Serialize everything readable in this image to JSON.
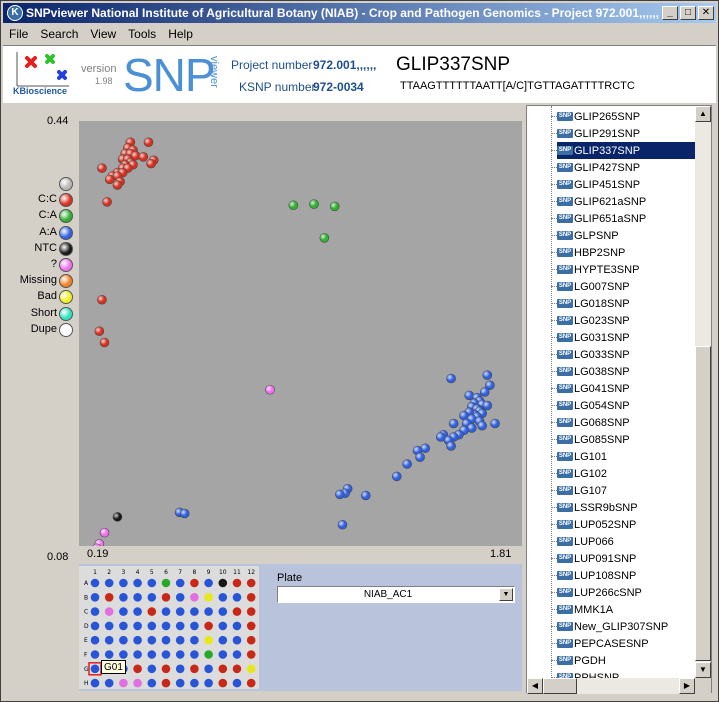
{
  "window": {
    "title": "SNPviewer   National Institute of Agricultural Botany (NIAB) - Crop and Pathogen Genomics - Project 972.001,,,,,,",
    "controls": [
      "_",
      "□",
      "✕"
    ]
  },
  "menu": [
    "File",
    "Search",
    "View",
    "Tools",
    "Help"
  ],
  "header": {
    "company": "KBioscience",
    "version_label": "version",
    "version": "1.98",
    "logo_text": "SNP",
    "logo_sub": "viewer",
    "project_label": "Project number",
    "project_value": "972.001,,,,,,",
    "ksnp_label": "KSNP number",
    "ksnp_value": "972-0034",
    "snp_name": "GLIP337SNP",
    "sequence": "TTAAGTTTTTTAATT[A/C]TGTTAGATTTTRCTC"
  },
  "plot": {
    "y_max": "0.44",
    "y_min": "0.08",
    "x_min": "0.19",
    "x_max": "1.81",
    "colors": {
      "C:C": "#d83020",
      "C:A": "#30b030",
      "A:A": "#3060e0",
      "NTC": "#181818",
      "?": "#f070f0",
      "blank": "#b8b8b8"
    }
  },
  "legend": [
    {
      "label": "",
      "color": "#b8b8b8"
    },
    {
      "label": "C:C",
      "color": "#d83020"
    },
    {
      "label": "C:A",
      "color": "#30b030"
    },
    {
      "label": "A:A",
      "color": "#3060e0"
    },
    {
      "label": "NTC",
      "color": "#181818"
    },
    {
      "label": "?",
      "color": "#f070f0"
    },
    {
      "label": "Missing",
      "color": "#f08020"
    },
    {
      "label": "Bad",
      "color": "#f0f020"
    },
    {
      "label": "Short",
      "color": "#30e0c0"
    },
    {
      "label": "Dupe",
      "color": "#ffffff"
    }
  ],
  "plate": {
    "label": "Plate",
    "selected": "NIAB_AC1",
    "columns": [
      "1",
      "2",
      "3",
      "4",
      "5",
      "6",
      "7",
      "8",
      "9",
      "10",
      "11",
      "12"
    ],
    "rows": [
      "A",
      "B",
      "C",
      "D",
      "E",
      "F",
      "G",
      "H"
    ],
    "tooltip": "G01",
    "wells": [
      "BBBBBGBRBKRR",
      "BRBBBRBPYBBR",
      "BPBBRBBBBBRR",
      "BBBBBBBBRBBR",
      "BBBBBBBBYBBR",
      "BBBBBBBBGBBR",
      "BBBRBRBRBRRY",
      "BBPPBRBBBRBR"
    ]
  },
  "snp_list": {
    "items": [
      "GLIP265SNP",
      "GLIP291SNP",
      "GLIP337SNP",
      "GLIP427SNP",
      "GLIP451SNP",
      "GLIP621aSNP",
      "GLIP651aSNP",
      "GLPSNP",
      "HBP2SNP",
      "HYPTE3SNP",
      "LG007SNP",
      "LG018SNP",
      "LG023SNP",
      "LG031SNP",
      "LG033SNP",
      "LG038SNP",
      "LG041SNP",
      "LG054SNP",
      "LG068SNP",
      "LG085SNP",
      "LG101",
      "LG102",
      "LG107",
      "LSSR9bSNP",
      "LUP052SNP",
      "LUP066",
      "LUP091SNP",
      "LUP108SNP",
      "LUP266cSNP",
      "MMK1A",
      "New_GLIP307SNP",
      "PEPCASESNP",
      "PGDH",
      "PPHSNP"
    ],
    "selected": "GLIP337SNP",
    "icon_text": "SNP"
  },
  "chart_data": {
    "type": "scatter",
    "x_range": [
      0.19,
      1.81
    ],
    "y_range": [
      0.08,
      0.44
    ],
    "series": [
      {
        "name": "C:C",
        "color": "#d83020",
        "points": [
          [
            0.35,
            0.43
          ],
          [
            0.42,
            0.43
          ],
          [
            0.34,
            0.425
          ],
          [
            0.36,
            0.423
          ],
          [
            0.33,
            0.42
          ],
          [
            0.35,
            0.42
          ],
          [
            0.37,
            0.418
          ],
          [
            0.4,
            0.417
          ],
          [
            0.32,
            0.415
          ],
          [
            0.34,
            0.415
          ],
          [
            0.44,
            0.414
          ],
          [
            0.35,
            0.412
          ],
          [
            0.43,
            0.411
          ],
          [
            0.33,
            0.41
          ],
          [
            0.36,
            0.41
          ],
          [
            0.32,
            0.407
          ],
          [
            0.34,
            0.407
          ],
          [
            0.24,
            0.407
          ],
          [
            0.3,
            0.403
          ],
          [
            0.32,
            0.403
          ],
          [
            0.28,
            0.4
          ],
          [
            0.3,
            0.4
          ],
          [
            0.31,
            0.395
          ],
          [
            0.27,
            0.397
          ],
          [
            0.3,
            0.392
          ],
          [
            0.26,
            0.377
          ],
          [
            0.24,
            0.29
          ],
          [
            0.23,
            0.262
          ],
          [
            0.25,
            0.252
          ]
        ]
      },
      {
        "name": "C:A",
        "color": "#30b030",
        "points": [
          [
            0.98,
            0.374
          ],
          [
            1.06,
            0.375
          ],
          [
            1.14,
            0.373
          ],
          [
            1.1,
            0.345
          ]
        ]
      },
      {
        "name": "A:A",
        "color": "#3060e0",
        "points": [
          [
            1.73,
            0.223
          ],
          [
            1.59,
            0.22
          ],
          [
            1.74,
            0.214
          ],
          [
            1.72,
            0.208
          ],
          [
            1.66,
            0.205
          ],
          [
            1.69,
            0.203
          ],
          [
            1.7,
            0.2
          ],
          [
            1.68,
            0.198
          ],
          [
            1.71,
            0.197
          ],
          [
            1.73,
            0.196
          ],
          [
            1.67,
            0.195
          ],
          [
            1.69,
            0.193
          ],
          [
            1.7,
            0.191
          ],
          [
            1.71,
            0.189
          ],
          [
            1.68,
            0.188
          ],
          [
            1.66,
            0.19
          ],
          [
            1.69,
            0.186
          ],
          [
            1.64,
            0.187
          ],
          [
            1.67,
            0.184
          ],
          [
            1.7,
            0.182
          ],
          [
            1.65,
            0.18
          ],
          [
            1.6,
            0.18
          ],
          [
            1.71,
            0.178
          ],
          [
            1.67,
            0.176
          ],
          [
            1.64,
            0.174
          ],
          [
            1.76,
            0.18
          ],
          [
            1.62,
            0.17
          ],
          [
            1.6,
            0.168
          ],
          [
            1.56,
            0.17
          ],
          [
            1.58,
            0.165
          ],
          [
            1.55,
            0.168
          ],
          [
            1.59,
            0.16
          ],
          [
            1.49,
            0.158
          ],
          [
            1.46,
            0.156
          ],
          [
            1.47,
            0.15
          ],
          [
            1.42,
            0.144
          ],
          [
            1.38,
            0.133
          ],
          [
            1.19,
            0.122
          ],
          [
            1.18,
            0.118
          ],
          [
            1.26,
            0.116
          ],
          [
            1.16,
            0.117
          ],
          [
            0.54,
            0.101
          ],
          [
            0.56,
            0.1
          ],
          [
            1.17,
            0.09
          ]
        ]
      },
      {
        "name": "NTC",
        "color": "#181818",
        "points": [
          [
            0.3,
            0.097
          ]
        ]
      },
      {
        "name": "?",
        "color": "#f070f0",
        "points": [
          [
            0.89,
            0.21
          ],
          [
            0.25,
            0.083
          ],
          [
            0.23,
            0.073
          ],
          [
            0.22,
            0.069
          ]
        ]
      }
    ]
  }
}
